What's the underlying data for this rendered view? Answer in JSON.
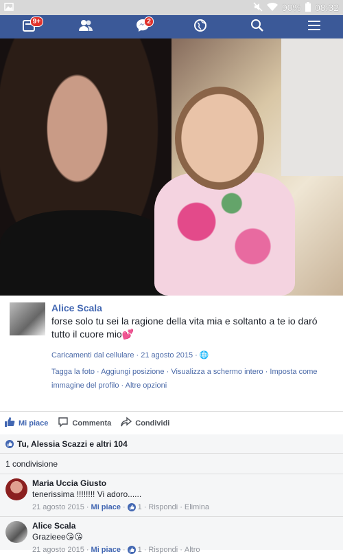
{
  "status": {
    "battery": "90%",
    "time": "08:32"
  },
  "nav": {
    "notifications_badge": "9+",
    "messages_badge": "2"
  },
  "post": {
    "author": "Alice Scala",
    "caption": "forse solo tu sei la ragione della vita mia e soltanto a te io daró tutto il cuore mio💕",
    "album": "Caricamenti dal cellulare",
    "date": "21 agosto 2015",
    "links": {
      "tag": "Tagga la foto",
      "location": "Aggiungi posizione",
      "fullscreen": "Visualizza a schermo intero",
      "profile_pic": "Imposta come immagine del profilo",
      "more": "Altre opzioni"
    }
  },
  "actions": {
    "like": "Mi piace",
    "comment": "Commenta",
    "share": "Condividi"
  },
  "likes_summary": "Tu, Alessia Scazzi e altri 104",
  "shares_summary": "1 condivisione",
  "comments": [
    {
      "name": "Maria Uccia Giusto",
      "text": "tenerissima !!!!!!!! Vi adoro......",
      "date": "21 agosto 2015",
      "like": "Mi piace",
      "likes": "1",
      "reply": "Rispondi",
      "extra": "Elimina"
    },
    {
      "name": "Alice Scala",
      "text": "Grazieee😘😘",
      "date": "21 agosto 2015",
      "like": "Mi piace",
      "likes": "1",
      "reply": "Rispondi",
      "extra": "Altro"
    }
  ]
}
